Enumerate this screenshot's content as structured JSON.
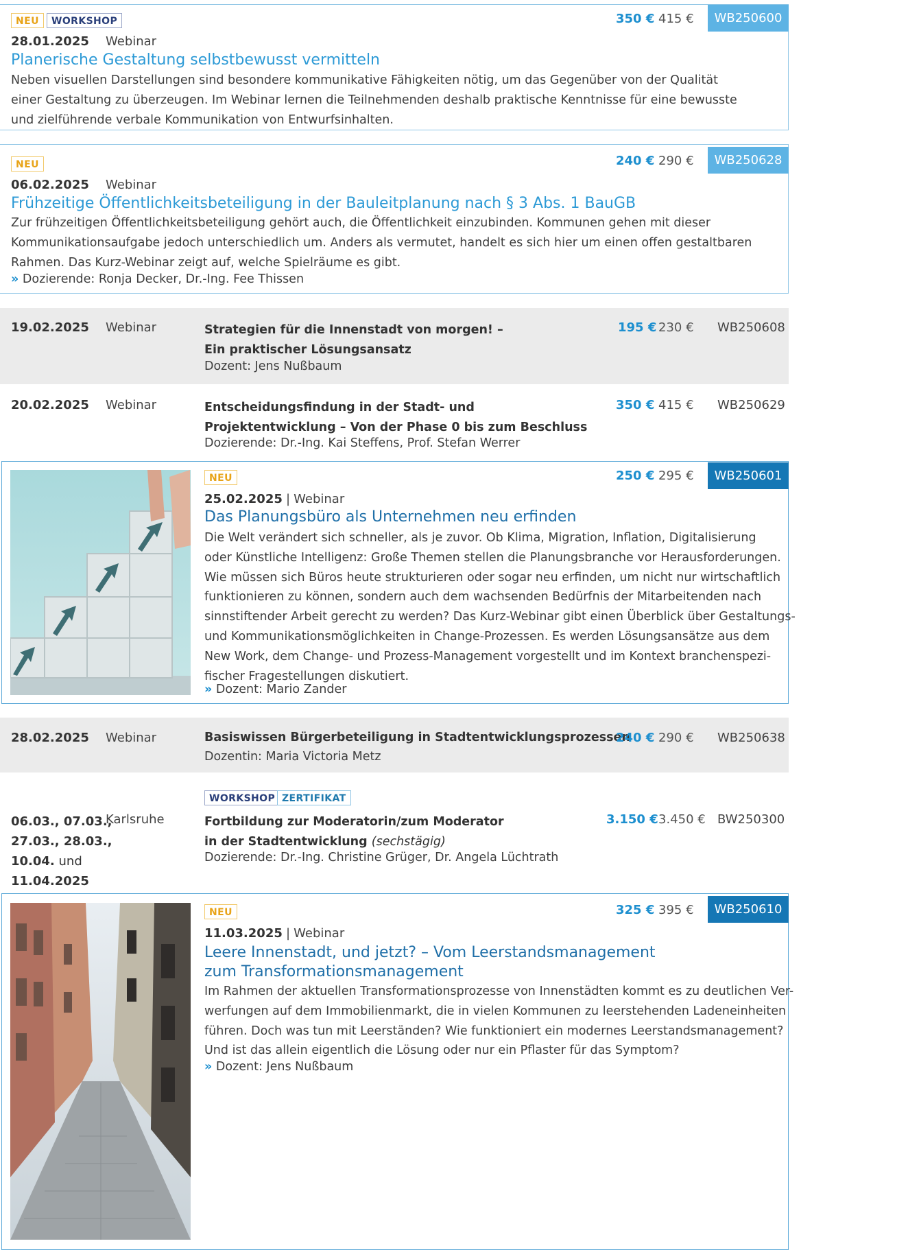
{
  "entry1": {
    "tags": [
      "NEU",
      "WORKSHOP"
    ],
    "price": "350 €",
    "price_old": "415 €",
    "code": "WB250600",
    "date": "28.01.2025",
    "type": "Webinar",
    "title": "Planerische Gestaltung selbstbewusst vermitteln",
    "description": [
      "Neben visuellen Darstellungen sind besondere kommunikative Fähigkeiten nötig, um das Gegenüber von der Qualität",
      "einer Gestaltung zu überzeugen. Im Webinar lernen die Teilnehmenden deshalb praktische Kenntnisse für eine bewusste",
      "und zielführende verbale Kommunikation von Entwurfsinhalten."
    ]
  },
  "entry2": {
    "tags": [
      "NEU"
    ],
    "price": "240 €",
    "price_old": "290 €",
    "code": "WB250628",
    "date": "06.02.2025",
    "type": "Webinar",
    "title": "Frühzeitige Öffentlichkeitsbeteiligung in der Bauleitplanung nach § 3 Abs. 1 BauGB",
    "description": [
      "Zur frühzeitigen Öffentlichkeitsbeteiligung gehört auch, die Öffentlichkeit einzubinden. Kommunen gehen mit dieser",
      "Kommunikationsaufgabe jedoch unterschiedlich um. Anders als vermutet, handelt es sich hier um einen offen gestaltbaren",
      "Rahmen. Das Kurz-Webinar zeigt auf, welche Spielräume es gibt."
    ],
    "chevron": "»",
    "speakers": "Dozierende: Ronja Decker, Dr.-Ing. Fee Thissen"
  },
  "entry3": {
    "date": "19.02.2025",
    "type": "Webinar",
    "title_lines": [
      "Strategien für die Innenstadt von morgen! –",
      "Ein praktischer Lösungsansatz"
    ],
    "speakers": "Dozent: Jens Nußbaum",
    "price": "195 €",
    "price_old": "230 €",
    "code": "WB250608"
  },
  "entry4": {
    "date": "20.02.2025",
    "type": "Webinar",
    "title_lines": [
      "Entscheidungsfindung in der Stadt- und",
      "Projektentwicklung – Von der Phase 0 bis zum Beschluss"
    ],
    "speakers": "Dozierende: Dr.-Ing. Kai Steffens, Prof. Stefan Werrer",
    "price": "350 €",
    "price_old": "415 €",
    "code": "WB250629"
  },
  "entry5": {
    "tags": [
      "NEU"
    ],
    "price": "250 €",
    "price_old": "295 €",
    "code": "WB250601",
    "date": "25.02.2025",
    "separator": "|",
    "type": "Webinar",
    "title": "Das Planungsbüro als Unternehmen neu erfinden",
    "description": [
      "Die Welt verändert sich schneller, als je zuvor. Ob Klima, Migration, Inflation, Digitalisierung",
      "oder Künstliche Intelligenz: Große Themen stellen die Planungsbranche vor Herausforderungen.",
      "Wie müssen sich Büros heute strukturieren oder sogar neu erfinden, um nicht nur wirtschaftlich",
      "funktionieren zu können, sondern auch dem wachsenden Bedürfnis der Mitarbeitenden nach",
      "sinnstiftender Arbeit gerecht zu werden? Das Kurz-Webinar gibt einen Überblick über Gestaltungs-",
      "und Kommunikationsmöglichkeiten in Change-Prozessen. Es werden Lösungsansätze aus dem",
      "New Work, dem Change- und Prozess-Management vorgestellt und im Kontext branchenspezi-",
      "fischer Fragestellungen diskutiert."
    ],
    "chevron": "»",
    "speakers": "Dozent: Mario Zander"
  },
  "entry6": {
    "date": "28.02.2025",
    "type": "Webinar",
    "title_lines": [
      "Basiswissen Bürgerbeteiligung in Stadtentwicklungsprozessen"
    ],
    "speakers": "Dozentin: Maria Victoria Metz",
    "price": "240 €",
    "price_old": "290 €",
    "code": "WB250638"
  },
  "entry7": {
    "tags": [
      "WORKSHOP",
      "ZERTIFIKAT"
    ],
    "date_lines": [
      "06.03., 07.03.,",
      "27.03., 28.03.,",
      "10.04.",
      "und",
      "11.04.2025"
    ],
    "type": "Karlsruhe",
    "title_lines": [
      "Fortbildung zur Moderatorin/zum Moderator",
      "in der Stadtentwicklung"
    ],
    "title_note": "(sechstägig)",
    "speakers": "Dozierende: Dr.-Ing. Christine Grüger, Dr. Angela Lüchtrath",
    "price": "3.150 €",
    "price_old": "3.450 €",
    "code": "BW250300"
  },
  "entry8": {
    "tags": [
      "NEU"
    ],
    "price": "325 €",
    "price_old": "395 €",
    "code": "WB250610",
    "date": "11.03.2025",
    "separator": "|",
    "type": "Webinar",
    "title_lines": [
      "Leere Innenstadt, und jetzt? – Vom Leerstandsmanagement",
      "zum Transformationsmanagement"
    ],
    "description": [
      "Im Rahmen der aktuellen Transformationsprozesse von Innenstädten kommt es zu deutlichen Ver-",
      "werfungen auf dem Immobilienmarkt, die in vielen Kommunen zu leerstehenden Ladeneinheiten",
      "führen. Doch was tun mit Leerständen? Wie funktioniert ein modernes Leerstandsmanagement?",
      "Und ist das allein eigentlich die Lösung oder nur ein Pflaster für das Symptom?"
    ],
    "chevron": "»",
    "speakers": "Dozent: Jens Nußbaum"
  },
  "colors": {
    "accent_light": "#5db3e4",
    "accent_dark": "#1577b5",
    "grey_row": "#ebebeb",
    "border": "#8fc6e6"
  }
}
